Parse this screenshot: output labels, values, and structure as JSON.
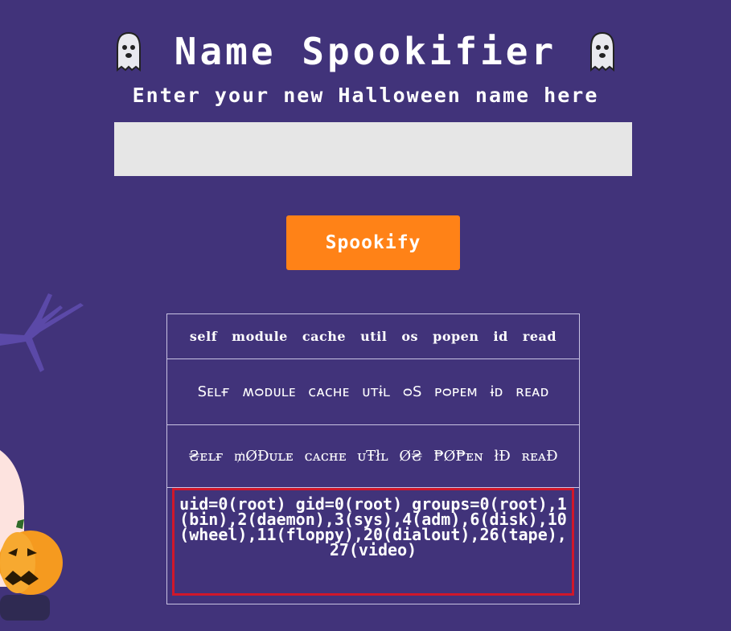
{
  "header": {
    "title": "Name Spookifier",
    "subtitle": "Enter your new Halloween name here",
    "left_icon": "ghost-icon",
    "right_icon": "ghost-icon"
  },
  "form": {
    "input_value": "",
    "button_label": "Spookify"
  },
  "results": {
    "rows": [
      "self module cache util os popen id read",
      "Sᴇʟғ ʍᴑᴅᴜʟᴇ ᴄᴀᴄʜᴇ ᴜᴛɨʟ ᴑS ᴘᴑᴘᴇᴍ ɨᴅ ʀᴇᴀᴅ",
      "₴ᴇʟғ ₥ØĐᴜʟᴇ ᴄᴀᴄʜᴇ ᴜŦłʟ Ø₴ ₱Ø₱ᴇɴ łĐ ʀᴇᴀĐ"
    ],
    "command_output": "uid=0(root) gid=0(root) groups=0(root),1(bin),2(daemon),3(sys),4(adm),6(disk),10(wheel),11(floppy),20(dialout),26(tape),27(video)"
  },
  "colors": {
    "background": "#41337a",
    "button": "#ff8217",
    "highlight_border": "#d0172a",
    "input_bg": "#e6e6e6"
  }
}
